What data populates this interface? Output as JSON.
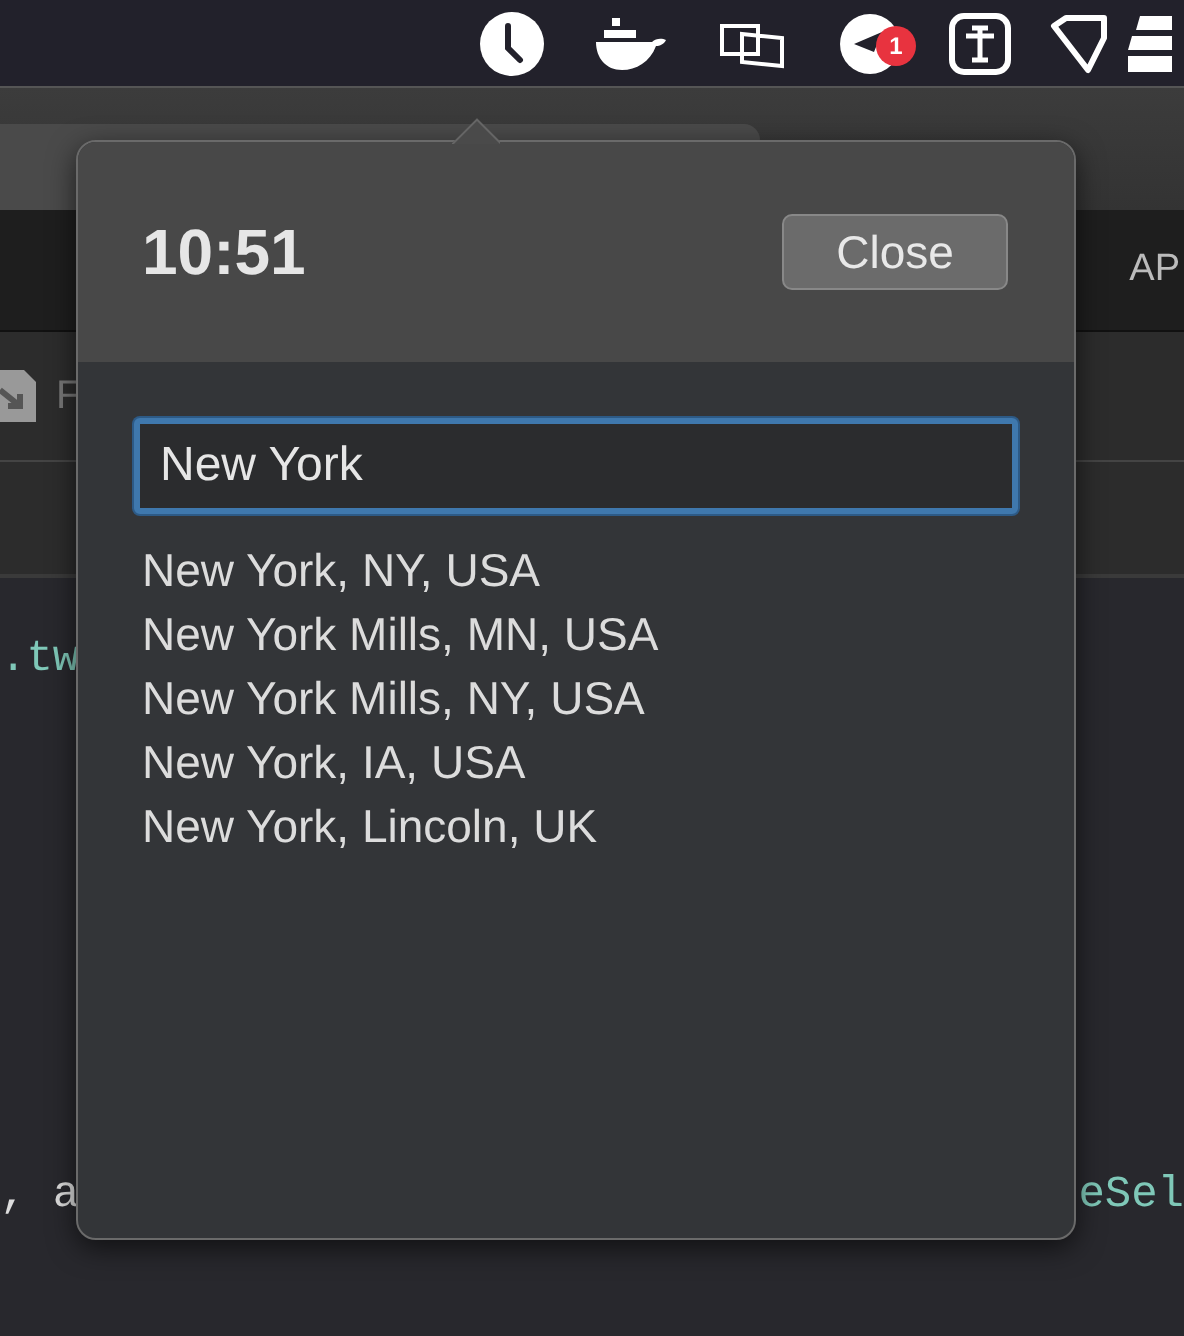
{
  "menu_bar": {
    "notification_badge": "1"
  },
  "background": {
    "tab_label": "AP",
    "file_label": "F",
    "code_lines": [
      {
        "text": ".tw"
      },
      {
        "text": ", a",
        "trailing": "eSel"
      }
    ]
  },
  "popover": {
    "time": "10:51",
    "close_button": "Close",
    "search": {
      "value": "New York",
      "focused": true
    },
    "results": [
      "New York, NY, USA",
      "New York Mills, MN, USA",
      "New York Mills, NY, USA",
      "New York, IA, USA",
      "New York, Lincoln, UK"
    ]
  }
}
